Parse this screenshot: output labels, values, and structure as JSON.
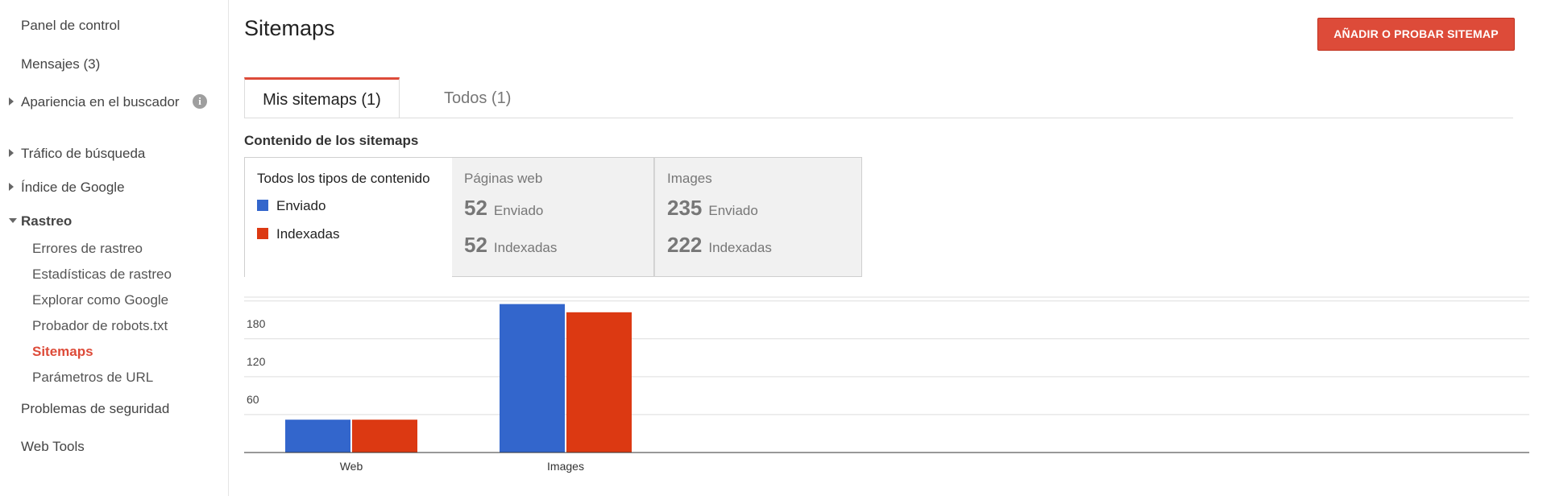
{
  "sidebar": {
    "panel": "Panel de control",
    "mensajes": "Mensajes (3)",
    "apariencia": "Apariencia en el buscador",
    "trafico": "Tráfico de búsqueda",
    "indice": "Índice de Google",
    "rastreo": "Rastreo",
    "rastreo_items": [
      "Errores de rastreo",
      "Estadísticas de rastreo",
      "Explorar como Google",
      "Probador de robots.txt",
      "Sitemaps",
      "Parámetros de URL"
    ],
    "seguridad": "Problemas de seguridad",
    "webtools": "Web Tools",
    "info_icon": "i"
  },
  "header": {
    "title": "Sitemaps",
    "add_button": "AÑADIR O PROBAR SITEMAP"
  },
  "tabs": [
    "Mis sitemaps (1)",
    "Todos (1)"
  ],
  "section_title": "Contenido de los sitemaps",
  "cards": {
    "legend_title": "Todos los tipos de contenido",
    "legend_sent": "Enviado",
    "legend_indexed": "Indexadas",
    "web": {
      "title": "Páginas web",
      "sent_num": "52",
      "sent_lbl": "Enviado",
      "idx_num": "52",
      "idx_lbl": "Indexadas"
    },
    "img": {
      "title": "Images",
      "sent_num": "235",
      "sent_lbl": "Enviado",
      "idx_num": "222",
      "idx_lbl": "Indexadas"
    }
  },
  "colors": {
    "accent": "#dd4b39",
    "sent": "#3366cc",
    "indexed": "#dc3912"
  },
  "chart_data": {
    "type": "bar",
    "categories": [
      "Web",
      "Images"
    ],
    "series": [
      {
        "name": "Enviado",
        "values": [
          52,
          235
        ]
      },
      {
        "name": "Indexadas",
        "values": [
          52,
          222
        ]
      }
    ],
    "yticks": [
      60,
      120,
      180,
      240
    ],
    "ylim": [
      0,
      240
    ],
    "grid": true
  }
}
